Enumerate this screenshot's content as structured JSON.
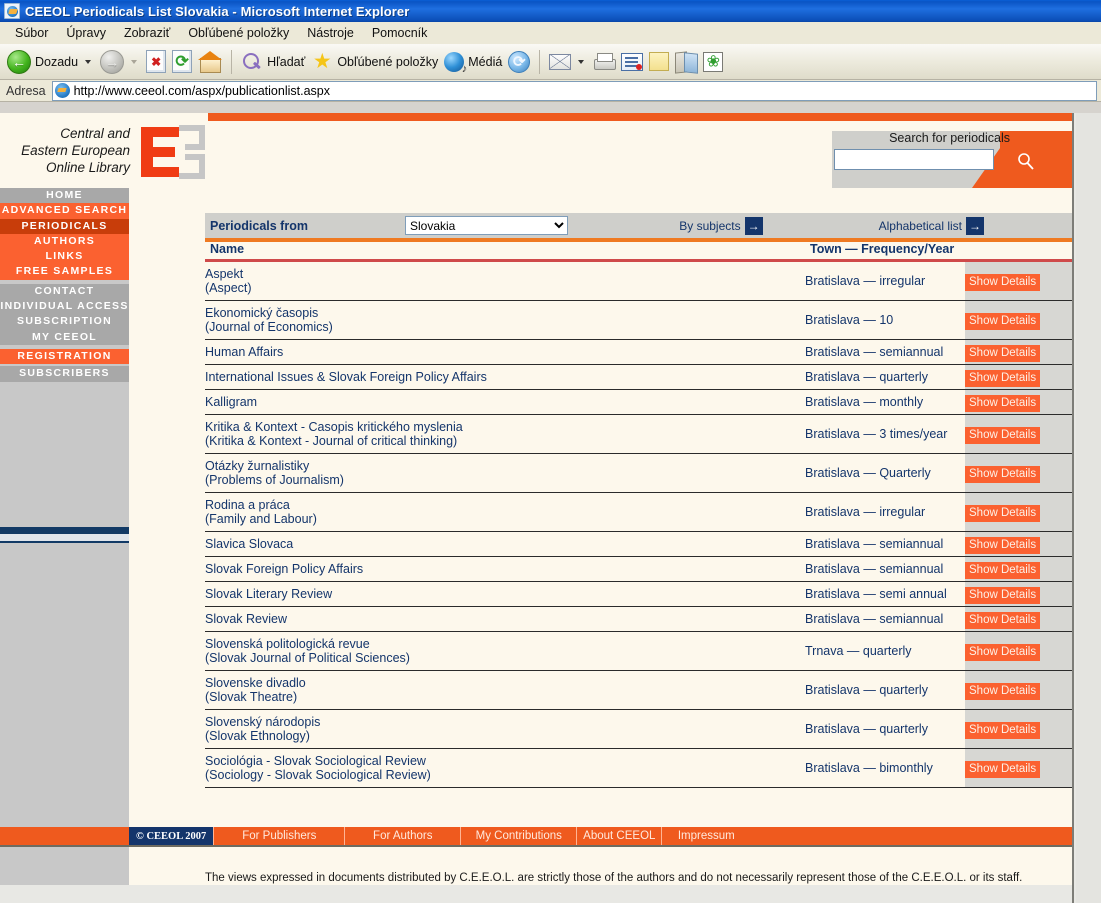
{
  "browser": {
    "title": "CEEOL Periodicals List Slovakia - Microsoft Internet Explorer",
    "menu": [
      "Súbor",
      "Úpravy",
      "Zobraziť",
      "Obľúbené položky",
      "Nástroje",
      "Pomocník"
    ],
    "toolbar": {
      "back_label": "Dozadu",
      "search_label": "Hľadať",
      "favorites_label": "Obľúbené položky",
      "media_label": "Médiá"
    },
    "address": {
      "label": "Adresa",
      "url": "http://www.ceeol.com/aspx/publicationlist.aspx"
    }
  },
  "site": {
    "brand_lines": [
      "Central and",
      "Eastern European",
      "Online Library"
    ],
    "logo_text": "E3",
    "search": {
      "label": "Search for periodicals",
      "value": "",
      "placeholder": ""
    }
  },
  "sidebar": {
    "items": [
      {
        "label": "HOME",
        "style": "grey"
      },
      {
        "label": "ADVANCED SEARCH",
        "style": "orange"
      },
      {
        "label": "PERIODICALS",
        "style": "active"
      },
      {
        "label": "AUTHORS",
        "style": "orange"
      },
      {
        "label": "LINKS",
        "style": "orange"
      },
      {
        "label": "FREE SAMPLES",
        "style": "orange"
      },
      {
        "label": "CONTACT",
        "style": "grey"
      },
      {
        "label": "INDIVIDUAL ACCESS",
        "style": "grey"
      },
      {
        "label": "SUBSCRIPTION",
        "style": "grey"
      },
      {
        "label": "MY CEEOL",
        "style": "grey"
      },
      {
        "label": "REGISTRATION",
        "style": "orange"
      },
      {
        "label": "SUBSCRIBERS",
        "style": "grey"
      }
    ]
  },
  "filterbar": {
    "label": "Periodicals from",
    "country_selected": "Slovakia",
    "country_options": [
      "Slovakia"
    ],
    "by_subjects": "By subjects",
    "alphabetical_list": "Alphabetical list",
    "arrow_glyph": "→"
  },
  "table": {
    "headers": {
      "name": "Name",
      "town": "Town — Frequency/Year"
    },
    "details_label": "Show Details",
    "rows": [
      {
        "name": "Aspekt",
        "subtitle": "(Aspect)",
        "town": "Bratislava — irregular"
      },
      {
        "name": "Ekonomický časopis",
        "subtitle": "(Journal of Economics)",
        "town": "Bratislava — 10"
      },
      {
        "name": "Human Affairs",
        "subtitle": "",
        "town": "Bratislava — semiannual"
      },
      {
        "name": "International Issues & Slovak Foreign Policy Affairs",
        "subtitle": "",
        "town": "Bratislava — quarterly"
      },
      {
        "name": "Kalligram",
        "subtitle": "",
        "town": "Bratislava — monthly"
      },
      {
        "name": "Kritika & Kontext - Casopis kritického myslenia",
        "subtitle": "(Kritika & Kontext - Journal of critical thinking)",
        "town": "Bratislava — 3 times/year"
      },
      {
        "name": "Otázky žurnalistiky",
        "subtitle": "(Problems of Journalism)",
        "town": "Bratislava — Quarterly"
      },
      {
        "name": "Rodina a práca",
        "subtitle": "(Family and Labour)",
        "town": "Bratislava — irregular"
      },
      {
        "name": "Slavica Slovaca",
        "subtitle": "",
        "town": "Bratislava — semiannual"
      },
      {
        "name": "Slovak Foreign Policy Affairs",
        "subtitle": "",
        "town": "Bratislava — semiannual"
      },
      {
        "name": "Slovak Literary Review",
        "subtitle": "",
        "town": "Bratislava — semi annual"
      },
      {
        "name": "Slovak Review",
        "subtitle": "",
        "town": "Bratislava — semiannual"
      },
      {
        "name": "Slovenská politologická revue",
        "subtitle": "(Slovak Journal of Political Sciences)",
        "town": "Trnava — quarterly"
      },
      {
        "name": "Slovenske divadlo",
        "subtitle": "(Slovak Theatre)",
        "town": "Bratislava — quarterly"
      },
      {
        "name": "Slovenský národopis",
        "subtitle": "(Slovak Ethnology)",
        "town": "Bratislava — quarterly"
      },
      {
        "name": "Sociológia - Slovak Sociological Review",
        "subtitle": "(Sociology - Slovak Sociological Review)",
        "town": "Bratislava — bimonthly"
      }
    ]
  },
  "footer": {
    "copyright": "© CEEOL 2007",
    "links": [
      "For Publishers",
      "For Authors",
      "My Contributions",
      "About CEEOL",
      "Impressum"
    ],
    "disclaimer": "The views expressed in documents distributed by C.E.E.O.L. are strictly those of the authors and do not necessarily represent those of the C.E.E.O.L. or its staff."
  },
  "colors": {
    "orange": "#ef5a1e",
    "orange_light": "#fb6130",
    "active_red": "#c83d0a",
    "navy": "#14356b",
    "cream": "#fdf8ec",
    "grey": "#c8c8c8"
  }
}
